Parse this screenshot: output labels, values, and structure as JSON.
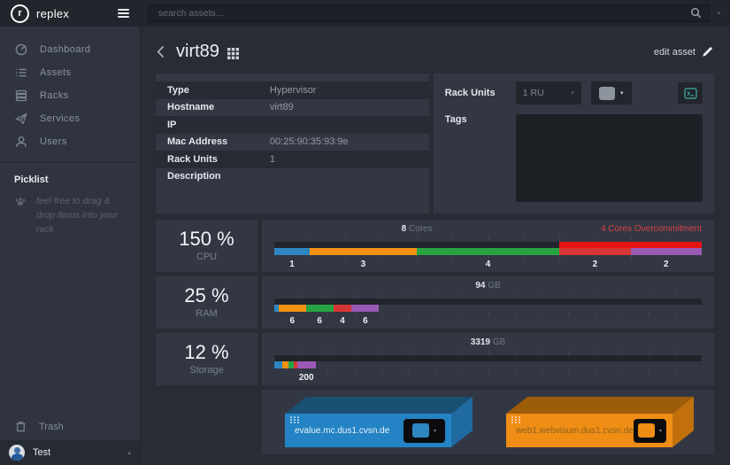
{
  "brand": {
    "name": "replex"
  },
  "topbar": {
    "search_placeholder": "search assets..."
  },
  "sidebar": {
    "nav": [
      {
        "label": "Dashboard"
      },
      {
        "label": "Assets"
      },
      {
        "label": "Racks"
      },
      {
        "label": "Services"
      },
      {
        "label": "Users"
      }
    ],
    "picklist": {
      "title": "Picklist",
      "hint": "feel free to drag & drop items into your rack"
    },
    "trash_label": "Trash",
    "user": {
      "name": "Test"
    }
  },
  "header": {
    "title": "virt89",
    "edit_label": "edit asset"
  },
  "details": {
    "rows": [
      {
        "label": "Type",
        "value": "Hypervisor"
      },
      {
        "label": "Hostname",
        "value": "virt89"
      },
      {
        "label": "IP",
        "value": ""
      },
      {
        "label": "Mac Address",
        "value": "00:25:90:35:93:9e"
      },
      {
        "label": "Rack Units",
        "value": "1"
      },
      {
        "label": "Description",
        "value": ""
      }
    ]
  },
  "rack_units": {
    "label": "Rack Units",
    "selected": "1 RU",
    "swatch_color": "#8e949e"
  },
  "tags": {
    "label": "Tags",
    "value": ""
  },
  "chart_data": {
    "type": "bar",
    "metrics": [
      {
        "name": "CPU",
        "percent": "150 %",
        "capacity": {
          "value": "8",
          "unit": "Cores",
          "fraction": 66.7
        },
        "overcommitment": {
          "label": "4 Cores Overcommitment",
          "fraction": 33.3,
          "color": "#e81414"
        },
        "ticks": 12,
        "segments": [
          {
            "label": "1",
            "value": 1,
            "width": 8.3,
            "color": "#2e86c1"
          },
          {
            "label": "3",
            "value": 3,
            "width": 25.0,
            "color": "#f39112"
          },
          {
            "label": "4",
            "value": 4,
            "width": 33.4,
            "color": "#28a344"
          },
          {
            "label": "2",
            "value": 2,
            "width": 16.65,
            "color": "#d63535"
          },
          {
            "label": "2",
            "value": 2,
            "width": 16.65,
            "color": "#9b59b6"
          }
        ]
      },
      {
        "name": "RAM",
        "percent": "25 %",
        "capacity": {
          "value": "94",
          "unit": "GB",
          "fraction": 100
        },
        "overcommitment": null,
        "ticks": 16,
        "segments": [
          {
            "label": "",
            "value": 1,
            "width": 1.0,
            "color": "#2e86c1"
          },
          {
            "label": "6",
            "value": 6,
            "width": 6.4,
            "color": "#f39112"
          },
          {
            "label": "6",
            "value": 6,
            "width": 6.4,
            "color": "#28a344"
          },
          {
            "label": "4",
            "value": 4,
            "width": 4.3,
            "color": "#d63535"
          },
          {
            "label": "6",
            "value": 6,
            "width": 6.4,
            "color": "#9b59b6"
          }
        ]
      },
      {
        "name": "Storage",
        "percent": "12 %",
        "capacity": {
          "value": "3319",
          "unit": "GB",
          "fraction": 100
        },
        "overcommitment": null,
        "ticks": 16,
        "segments": [
          {
            "label": "",
            "value": null,
            "width": 1.9,
            "color": "#2e86c1"
          },
          {
            "label": "",
            "value": null,
            "width": 1.5,
            "color": "#f39112"
          },
          {
            "label": "",
            "value": null,
            "width": 1.2,
            "color": "#28a344"
          },
          {
            "label": "",
            "value": null,
            "width": 0.7,
            "color": "#d63535"
          },
          {
            "label": "200",
            "value": 200,
            "width": 4.4,
            "color": "#9b59b6"
          }
        ]
      }
    ]
  },
  "vms": [
    {
      "name": "evalue.mc.dus1.cvsn.de",
      "name_color": "#eaf2f8",
      "faces": {
        "front": "#2483c4",
        "side": "#1f6aa0",
        "top": "#1a4f74"
      },
      "swatch": "#2e86c1"
    },
    {
      "name": "web1.webvisum.dus1.cvsn.de",
      "name_color": "#8a6220",
      "faces": {
        "front": "#ef8d15",
        "side": "#c1700c",
        "top": "#9c5c08"
      },
      "swatch": "#ef8d15"
    }
  ],
  "colors": {
    "console_icon": "#3fb0a6",
    "overcommit_text": "#d84343"
  }
}
